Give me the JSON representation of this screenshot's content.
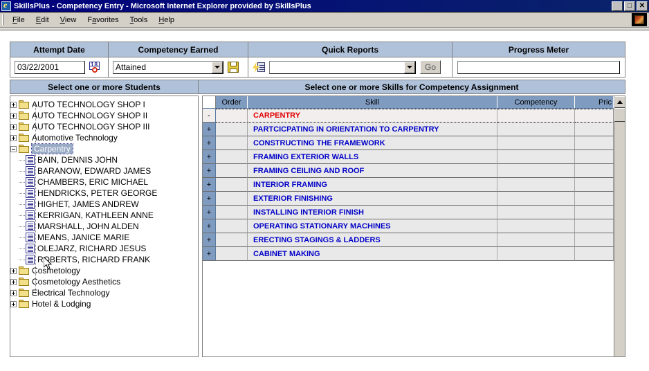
{
  "window": {
    "title": "SkillsPlus - Competency Entry - Microsoft Internet Explorer provided by SkillsPlus",
    "icon": "ie-document-icon",
    "minimize_label": "_",
    "maximize_label": "□",
    "close_label": "✕"
  },
  "menubar": {
    "items": [
      {
        "label": "File",
        "accel": "F"
      },
      {
        "label": "Edit",
        "accel": "E"
      },
      {
        "label": "View",
        "accel": "V"
      },
      {
        "label": "Favorites",
        "accel": "a"
      },
      {
        "label": "Tools",
        "accel": "T"
      },
      {
        "label": "Help",
        "accel": "H"
      }
    ],
    "brand_icon": "windows-flag-logo"
  },
  "toolbar": {
    "attempt_date": {
      "header": "Attempt Date",
      "value": "03/22/2001",
      "picker_icon": "calendar-date-picker-icon"
    },
    "competency_earned": {
      "header": "Competency Earned",
      "selected": "Attained",
      "options": [
        "Attained"
      ],
      "save_icon": "floppy-disk-save-icon"
    },
    "quick_reports": {
      "header": "Quick Reports",
      "report_icon": "quick-report-icon",
      "selected": "",
      "placeholder": "",
      "go_label": "Go"
    },
    "progress_meter": {
      "header": "Progress Meter",
      "value": ""
    }
  },
  "sections": {
    "students": "Select one or more Students",
    "skills": "Select one or more Skills for Competency Assignment"
  },
  "tree": {
    "nodes": [
      {
        "label": "AUTO TECHNOLOGY SHOP I",
        "type": "folder",
        "state": "collapsed",
        "level": 0,
        "selected": false
      },
      {
        "label": "AUTO TECHNOLOGY SHOP II",
        "type": "folder",
        "state": "collapsed",
        "level": 0,
        "selected": false
      },
      {
        "label": "AUTO TECHNOLOGY SHOP III",
        "type": "folder",
        "state": "collapsed",
        "level": 0,
        "selected": false
      },
      {
        "label": "Automotive Technology",
        "type": "folder",
        "state": "collapsed",
        "level": 0,
        "selected": false
      },
      {
        "label": "Carpentry",
        "type": "folder",
        "state": "expanded",
        "level": 0,
        "selected": true
      },
      {
        "label": "BAIN, DENNIS JOHN",
        "type": "student",
        "state": "leaf",
        "level": 1,
        "selected": false
      },
      {
        "label": "BARANOW, EDWARD JAMES",
        "type": "student",
        "state": "leaf",
        "level": 1,
        "selected": false
      },
      {
        "label": "CHAMBERS, ERIC MICHAEL",
        "type": "student",
        "state": "leaf",
        "level": 1,
        "selected": false
      },
      {
        "label": "HENDRICKS, PETER GEORGE",
        "type": "student",
        "state": "leaf",
        "level": 1,
        "selected": false
      },
      {
        "label": "HIGHET, JAMES ANDREW",
        "type": "student",
        "state": "leaf",
        "level": 1,
        "selected": false
      },
      {
        "label": "KERRIGAN, KATHLEEN ANNE",
        "type": "student",
        "state": "leaf",
        "level": 1,
        "selected": false
      },
      {
        "label": "MARSHALL, JOHN ALDEN",
        "type": "student",
        "state": "leaf",
        "level": 1,
        "selected": false
      },
      {
        "label": "MEANS, JANICE MARIE",
        "type": "student",
        "state": "leaf",
        "level": 1,
        "selected": false
      },
      {
        "label": "OLEJARZ, RICHARD JESUS",
        "type": "student",
        "state": "leaf",
        "level": 1,
        "selected": false
      },
      {
        "label": "ROBERTS, RICHARD FRANK",
        "type": "student",
        "state": "leaf",
        "level": 1,
        "selected": false
      },
      {
        "label": "Cosmetology",
        "type": "folder",
        "state": "collapsed",
        "level": 0,
        "selected": false
      },
      {
        "label": "Cosmetology Aesthetics",
        "type": "folder",
        "state": "collapsed",
        "level": 0,
        "selected": false
      },
      {
        "label": "Electrical Technology",
        "type": "folder",
        "state": "collapsed",
        "level": 0,
        "selected": false
      },
      {
        "label": "Hotel & Lodging",
        "type": "folder",
        "state": "collapsed",
        "level": 0,
        "selected": false
      }
    ]
  },
  "grid": {
    "columns": [
      "",
      "Order",
      "Skill",
      "Competency",
      "Pric"
    ],
    "rows": [
      {
        "expander": "-",
        "order": "",
        "skill": "CARPENTRY",
        "competency": "",
        "pric": "",
        "level": "root"
      },
      {
        "expander": "+",
        "order": "",
        "skill": "PARTCICPATING IN ORIENTATION TO CARPENTRY",
        "competency": "",
        "pric": "",
        "level": "child"
      },
      {
        "expander": "+",
        "order": "",
        "skill": "CONSTRUCTING THE FRAMEWORK",
        "competency": "",
        "pric": "",
        "level": "child"
      },
      {
        "expander": "+",
        "order": "",
        "skill": "FRAMING EXTERIOR WALLS",
        "competency": "",
        "pric": "",
        "level": "child"
      },
      {
        "expander": "+",
        "order": "",
        "skill": "FRAMING CEILING AND ROOF",
        "competency": "",
        "pric": "",
        "level": "child"
      },
      {
        "expander": "+",
        "order": "",
        "skill": "INTERIOR FRAMING",
        "competency": "",
        "pric": "",
        "level": "child"
      },
      {
        "expander": "+",
        "order": "",
        "skill": "EXTERIOR FINISHING",
        "competency": "",
        "pric": "",
        "level": "child"
      },
      {
        "expander": "+",
        "order": "",
        "skill": "INSTALLING INTERIOR FINISH",
        "competency": "",
        "pric": "",
        "level": "child"
      },
      {
        "expander": "+",
        "order": "",
        "skill": "OPERATING STATIONARY MACHINES",
        "competency": "",
        "pric": "",
        "level": "child"
      },
      {
        "expander": "+",
        "order": "",
        "skill": "ERECTING STAGINGS & LADDERS",
        "competency": "",
        "pric": "",
        "level": "child"
      },
      {
        "expander": "+",
        "order": "",
        "skill": "CABINET MAKING",
        "competency": "",
        "pric": "",
        "level": "child"
      }
    ],
    "scrollbar": {
      "up_arrow": "scroll-up-arrow-icon"
    }
  },
  "colors": {
    "titlebar": "#00007e",
    "panel_header": "#b0c2da",
    "grid_header": "#7f9cc0",
    "root_skill_text": "#e00000",
    "child_skill_text": "#0000c8",
    "chrome": "#d4d0c8"
  }
}
